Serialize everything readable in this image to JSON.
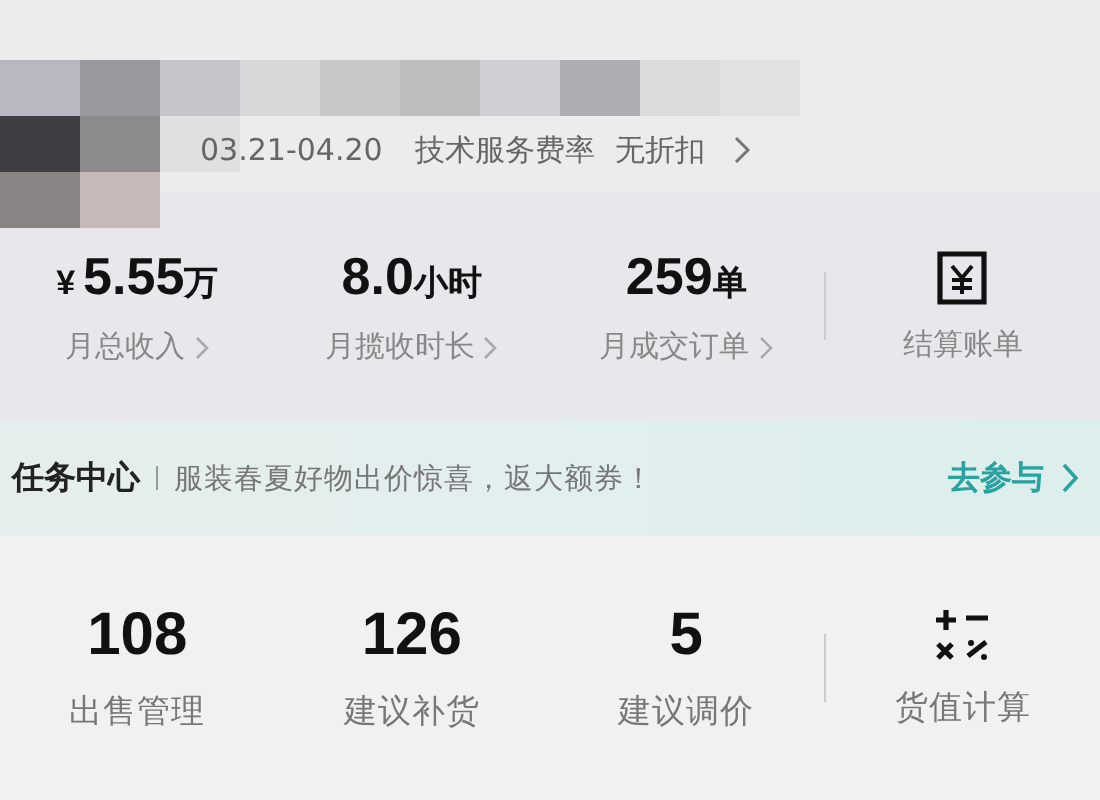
{
  "header": {
    "period": "03.21-04.20",
    "fee_label": "技术服务费率",
    "fee_value": "无折扣"
  },
  "stats": [
    {
      "kind": "stat",
      "prefix": "¥",
      "value": "5.55",
      "unit": "万",
      "label": "月总收入"
    },
    {
      "kind": "stat",
      "value": "8.0",
      "unit": "小时",
      "label": "月揽收时长"
    },
    {
      "kind": "stat",
      "value": "259",
      "unit": "单",
      "label": "月成交订单"
    },
    {
      "kind": "action",
      "label": "结算账单"
    }
  ],
  "task": {
    "title": "任务中心",
    "message": "服装春夏好物出价惊喜，返大额券！",
    "action": "去参与"
  },
  "tools": [
    {
      "kind": "stat",
      "value": "108",
      "label": "出售管理"
    },
    {
      "kind": "stat",
      "value": "126",
      "label": "建议补货"
    },
    {
      "kind": "stat",
      "value": "5",
      "label": "建议调价"
    },
    {
      "kind": "action",
      "label": "货值计算"
    }
  ]
}
